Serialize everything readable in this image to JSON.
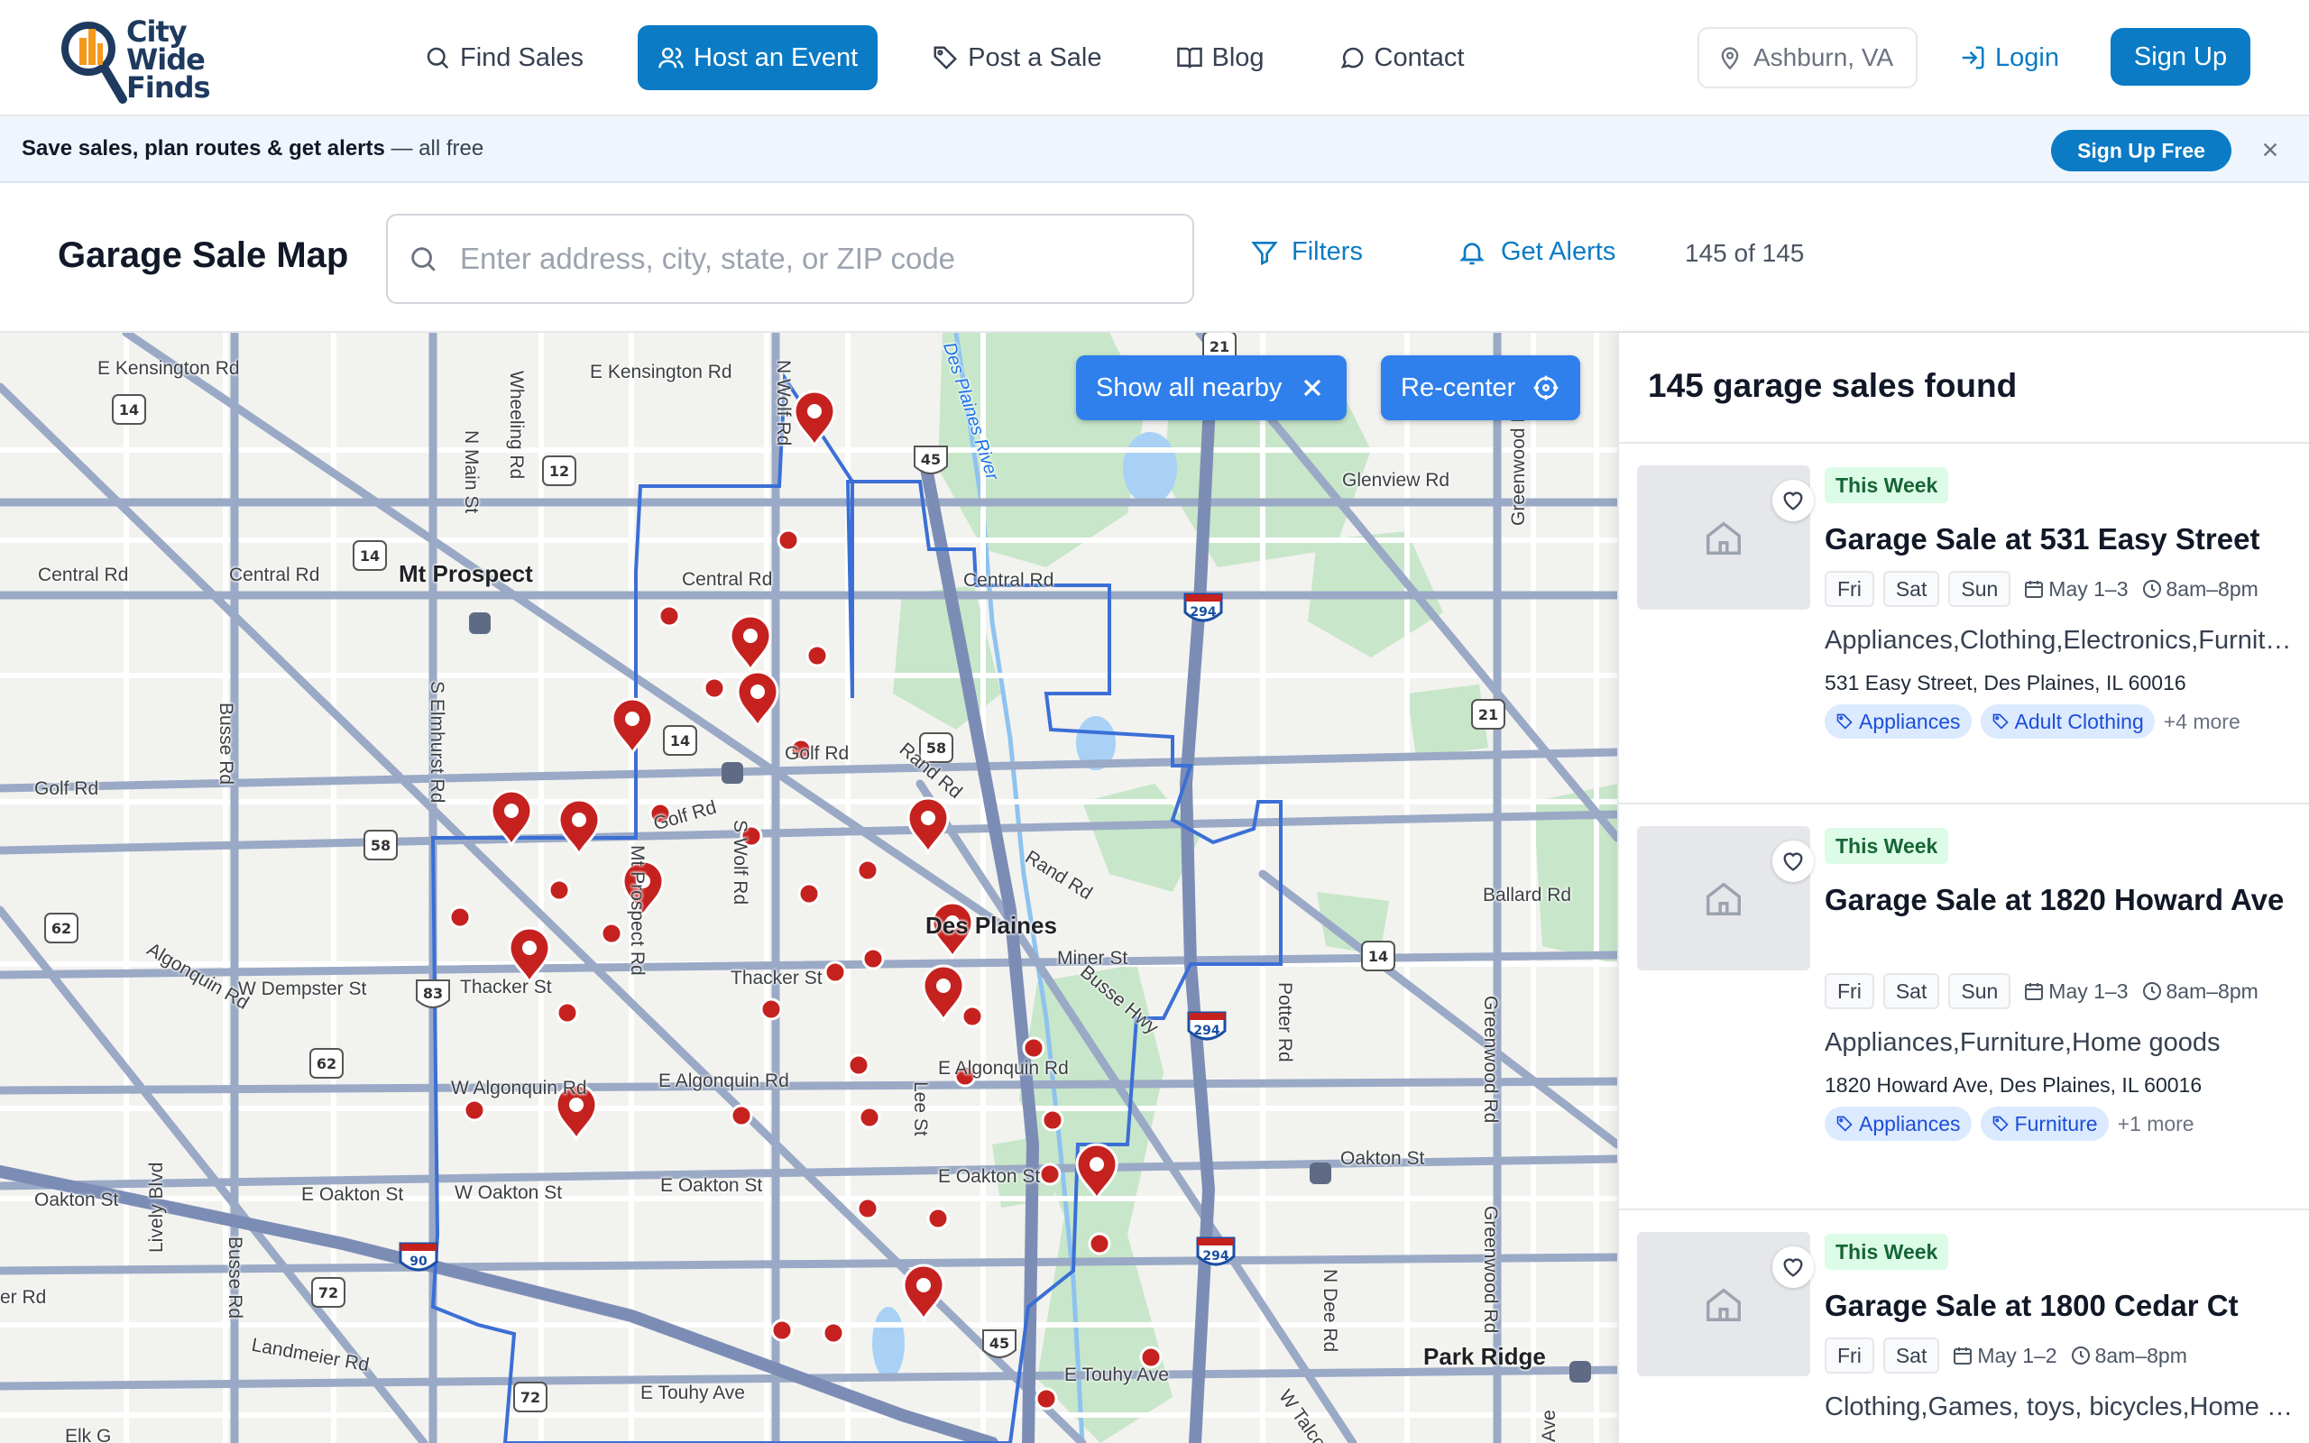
{
  "brand": {
    "name_line1": "City",
    "name_line2": "Wide",
    "name_line3": "Finds"
  },
  "nav": {
    "items": [
      {
        "label": "Find Sales",
        "icon": "search-icon"
      },
      {
        "label": "Host an Event",
        "icon": "users-icon",
        "active": true
      },
      {
        "label": "Post a Sale",
        "icon": "tag-icon"
      },
      {
        "label": "Blog",
        "icon": "book-icon"
      },
      {
        "label": "Contact",
        "icon": "chat-icon"
      }
    ],
    "location": "Ashburn, VA",
    "login": "Login",
    "signup": "Sign Up"
  },
  "promo": {
    "bold_text": "Save sales, plan routes & get alerts",
    "light_text": " — all free",
    "button": "Sign Up Free"
  },
  "toolbar": {
    "title": "Garage Sale Map",
    "search_placeholder": "Enter address, city, state, or ZIP code",
    "filters": "Filters",
    "alerts": "Get Alerts",
    "count": "145 of 145"
  },
  "map": {
    "show_nearby": "Show all nearby",
    "recenter": "Re-center",
    "labels": {
      "kensington_w": "E Kensington Rd",
      "kensington_e": "E Kensington Rd",
      "wheeling": "Wheeling Rd",
      "n_wolf": "N Wolf Rd",
      "n_main": "N Main St",
      "des_plaines_river": "Des Plaines River",
      "glenview": "Glenview Rd",
      "central_w": "Central Rd",
      "central_m": "Central Rd",
      "central_e": "Central Rd",
      "central_ee": "Central Rd",
      "mt_prospect": "Mt Prospect",
      "greenwood_n": "Greenwood Rd",
      "busse": "Busse Rd",
      "s_elmhurst": "S Elmhurst Rd",
      "golf_w": "Golf Rd",
      "golf_m": "Golf Rd",
      "golf_e": "Golf Rd",
      "rand_1": "Rand Rd",
      "rand_2": "Rand Rd",
      "s_wolf": "S Wolf Rd",
      "ballard": "Ballard Rd",
      "mt_prospect_rd": "Mt Prospect Rd",
      "des_plaines": "Des Plaines",
      "miner": "Miner St",
      "busse_hwy": "Busse Hwy",
      "potter": "Potter Rd",
      "algonquin_rd": "Algonquin Rd",
      "w_dempster": "W Dempster St",
      "thacker_w": "Thacker St",
      "thacker_m": "Thacker St",
      "greenwood_m": "Greenwood Rd",
      "e_algonquin_e": "E Algonquin Rd",
      "w_algonquin": "W Algonquin Rd",
      "e_algonquin": "E Algonquin Rd",
      "lee": "Lee St",
      "oakton_far": "Oakton St",
      "lively": "Lively Blvd",
      "e_oakton_w": "E Oakton St",
      "w_oakton": "W Oakton St",
      "e_oakton_m": "E Oakton St",
      "e_oakton_e": "E Oakton St",
      "oakton_st": "Oakton St",
      "greenwood_s": "Greenwood Rd",
      "busse_s": "Busse Rd",
      "er_rd": "er Rd",
      "n_dee": "N Dee Rd",
      "landmeier": "Landmeier Rd",
      "park_ridge": "Park Ridge",
      "e_touhy_w": "E Touhy Ave",
      "e_touhy_e": "E Touhy Ave",
      "w_talcott": "W Talcott",
      "elk_grove": "Elk G",
      "ave": "Ave"
    },
    "shields": [
      "14",
      "12",
      "45",
      "21",
      "14",
      "14",
      "294",
      "21",
      "58",
      "14",
      "58",
      "62",
      "83",
      "62",
      "14",
      "294",
      "72",
      "90",
      "72",
      "45",
      "294"
    ]
  },
  "panel": {
    "heading": "145 garage sales found",
    "cards": [
      {
        "badge": "This Week",
        "title": "Garage Sale at 531 Easy Street",
        "days": [
          "Fri",
          "Sat",
          "Sun"
        ],
        "dates": "May 1–3",
        "time": "8am–8pm",
        "categories": "Appliances,Clothing,Electronics,Furniture,Home goods",
        "address": "531 Easy Street, Des Plaines, IL 60016",
        "tags": [
          "Appliances",
          "Adult Clothing"
        ],
        "more": "+4 more"
      },
      {
        "badge": "This Week",
        "title": "Garage Sale at 1820 Howard Ave",
        "days": [
          "Fri",
          "Sat",
          "Sun"
        ],
        "dates": "May 1–3",
        "time": "8am–8pm",
        "categories": "Appliances,Furniture,Home goods",
        "address": "1820 Howard Ave, Des Plaines, IL 60016",
        "tags": [
          "Appliances",
          "Furniture"
        ],
        "more": "+1 more"
      },
      {
        "badge": "This Week",
        "title": "Garage Sale at 1800 Cedar Ct",
        "days": [
          "Fri",
          "Sat"
        ],
        "dates": "May 1–2",
        "time": "8am–8pm",
        "categories": "Clothing,Games, toys, bicycles,Home goods"
      }
    ]
  },
  "colors": {
    "accent": "#0a7bc4",
    "map_button": "#2f80ed",
    "pin": "#c5221f",
    "boundary": "#3b6fd6",
    "park": "#c8e6c9"
  }
}
